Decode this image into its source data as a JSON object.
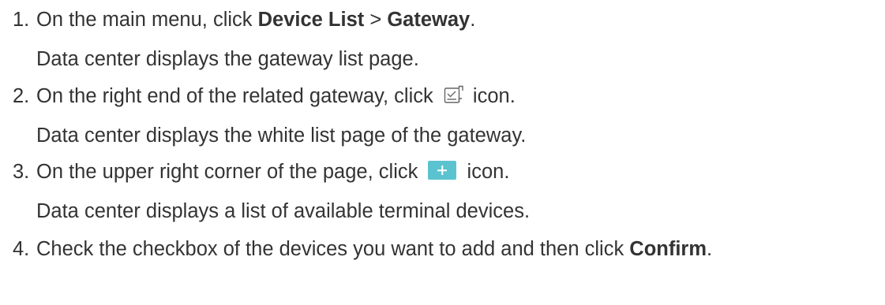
{
  "steps": [
    {
      "number": "1.",
      "instruction": {
        "t1": "On the main menu, click ",
        "b1": "Device List",
        "t2": " > ",
        "b2": "Gateway",
        "t3": "."
      },
      "result": "Data center displays the gateway list page."
    },
    {
      "number": "2.",
      "instruction": {
        "t1": "On the right end of the related gateway, click ",
        "icon": "whitelist-check-icon",
        "t2": " icon."
      },
      "result": "Data center displays the white list page of the gateway."
    },
    {
      "number": "3.",
      "instruction": {
        "t1": "On the upper right corner of the page, click ",
        "icon": "add-plus-icon",
        "t2": " icon."
      },
      "result": "Data center displays a list of available terminal devices."
    },
    {
      "number": "4.",
      "instruction": {
        "t1": "Check the checkbox of the devices you want to add and then click ",
        "b1": "Confirm",
        "t2": "."
      }
    }
  ],
  "colors": {
    "text": "#333333",
    "plus_icon_bg": "#5bc3d0"
  }
}
